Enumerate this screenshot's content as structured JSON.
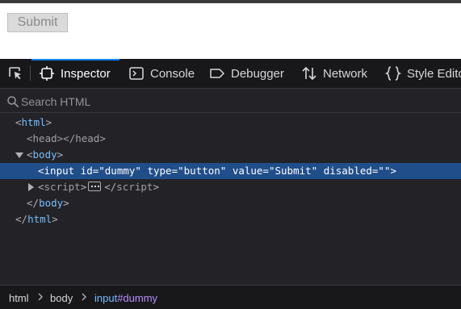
{
  "page": {
    "submit_label": "Submit"
  },
  "toolbar": {
    "tabs": [
      {
        "label": "Inspector",
        "icon": "inspector-icon"
      },
      {
        "label": "Console",
        "icon": "console-icon"
      },
      {
        "label": "Debugger",
        "icon": "debugger-icon"
      },
      {
        "label": "Network",
        "icon": "network-icon"
      },
      {
        "label": "Style Editor",
        "icon": "style-editor-icon"
      }
    ],
    "active_tab": "Inspector"
  },
  "search": {
    "placeholder": "Search HTML",
    "value": ""
  },
  "markup": {
    "html_open": "html",
    "head": "head",
    "body_open": "body",
    "selected": "<input id=\"dummy\" type=\"button\" value=\"Submit\" disabled=\"\">",
    "script": "script",
    "body_close": "body",
    "html_close": "html"
  },
  "breadcrumbs": {
    "items": [
      "html",
      "body"
    ],
    "current_tag": "input",
    "current_id": "#dummy"
  },
  "colors": {
    "accent": "#0a84ff",
    "selection": "#204e8a",
    "tag": "#75bfff",
    "id": "#b98eff",
    "background": "#232327"
  }
}
